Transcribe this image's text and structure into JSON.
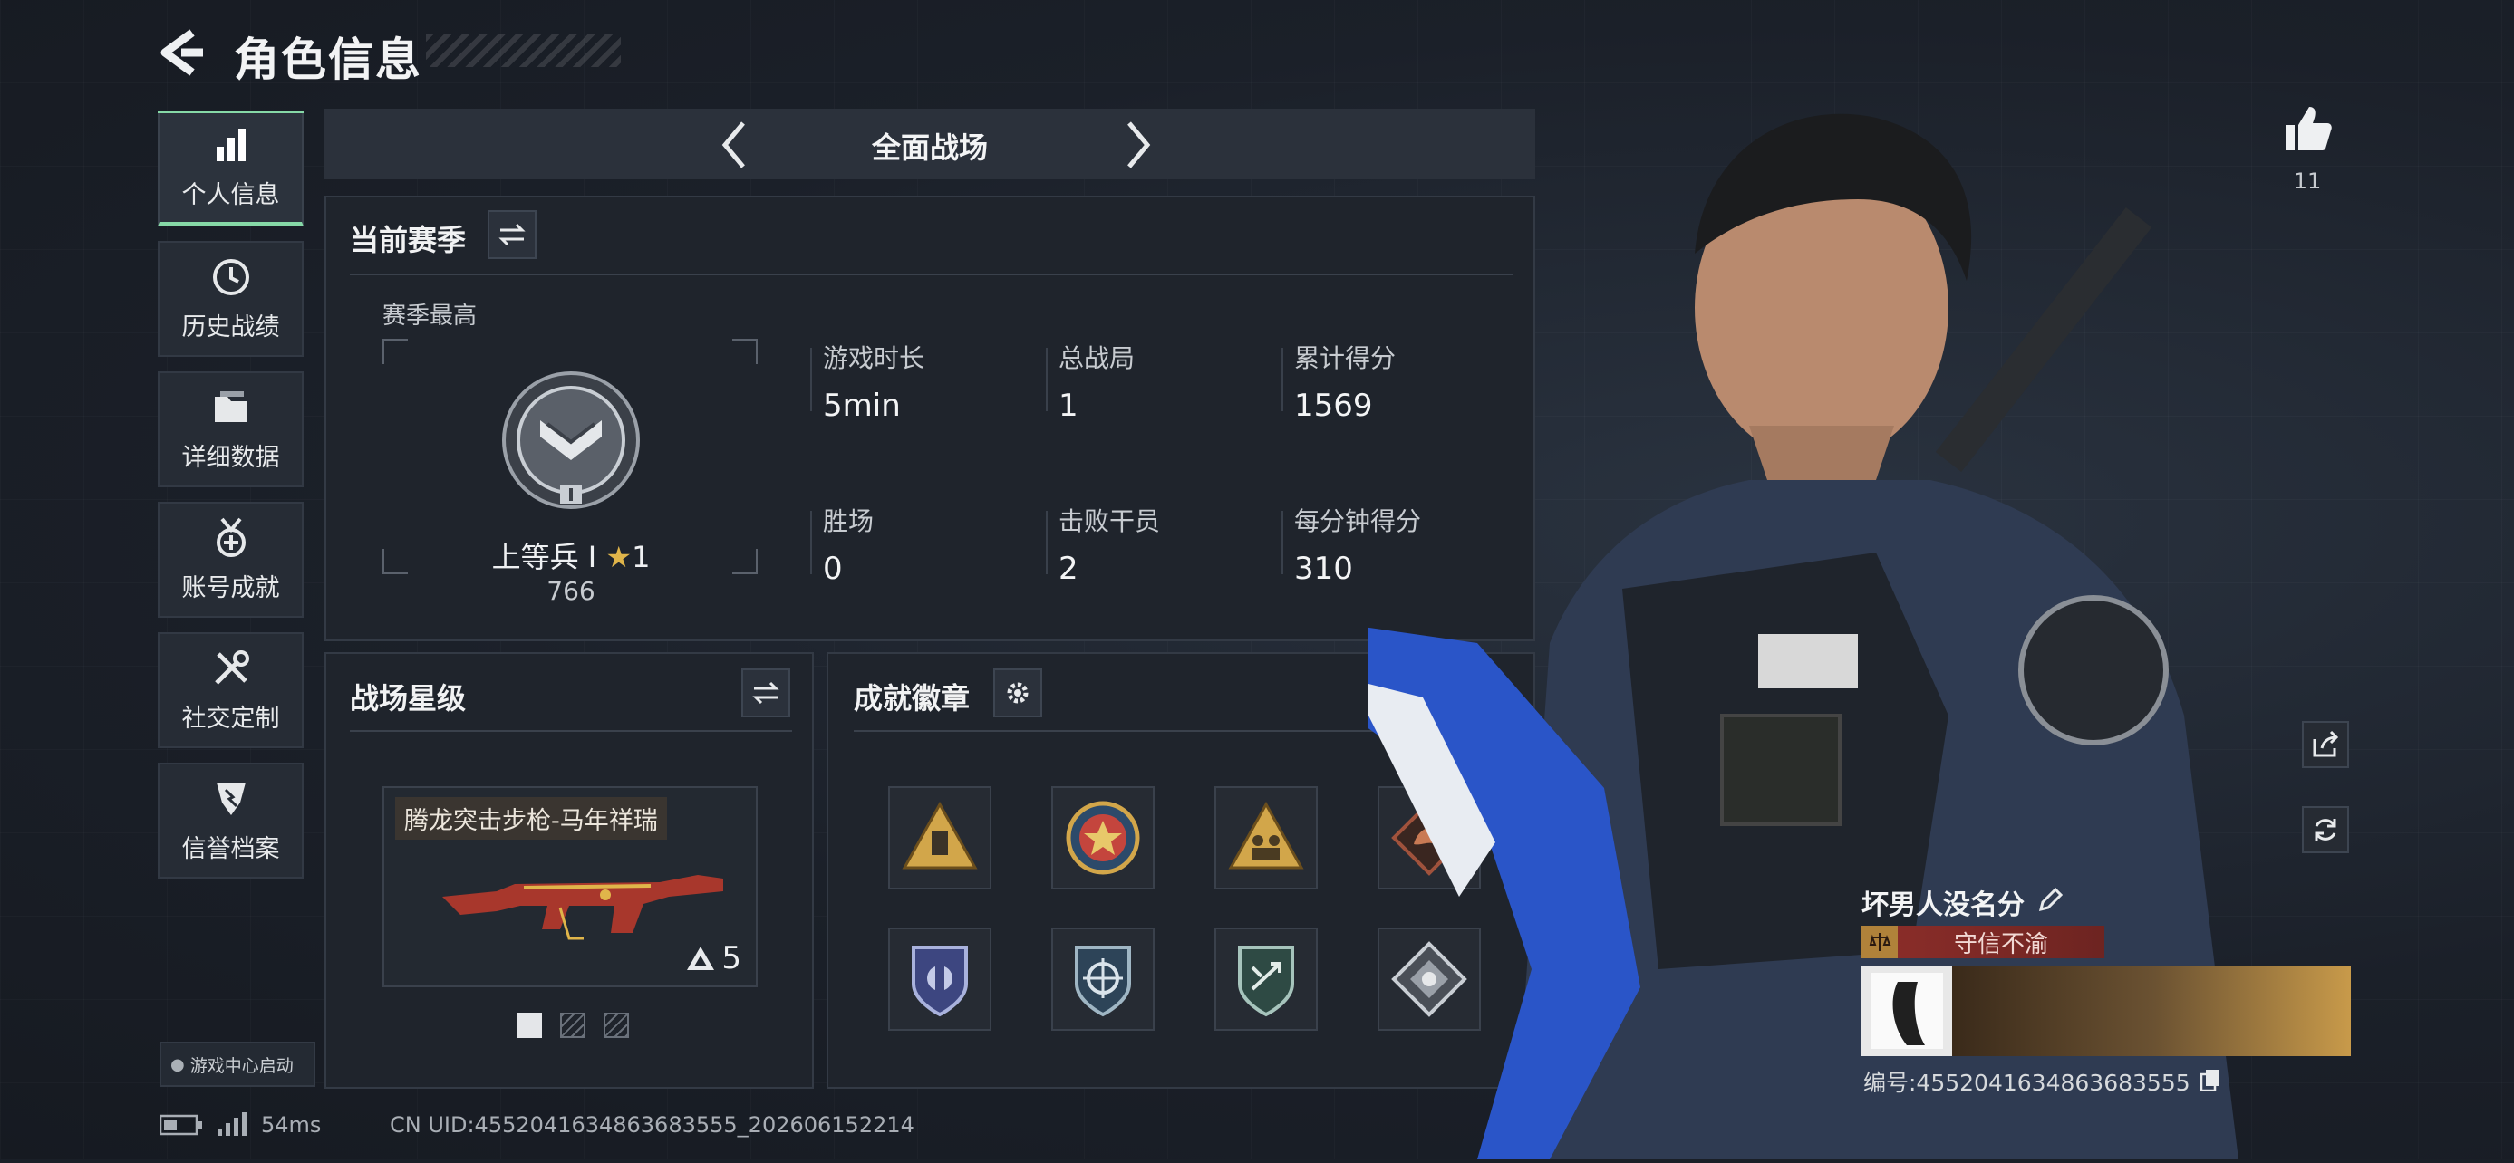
{
  "header": {
    "title": "角色信息"
  },
  "sidebar": {
    "items": [
      {
        "label": "个人信息",
        "icon": "bar-chart-icon",
        "active": true
      },
      {
        "label": "历史战绩",
        "icon": "history-clock-icon"
      },
      {
        "label": "详细数据",
        "icon": "folder-icon"
      },
      {
        "label": "账号成就",
        "icon": "achievement-medal-icon"
      },
      {
        "label": "社交定制",
        "icon": "tools-icon"
      },
      {
        "label": "信誉档案",
        "icon": "credit-shield-icon"
      }
    ],
    "game_center": "游戏中心启动"
  },
  "mode_bar": {
    "label": "全面战场"
  },
  "season": {
    "title": "当前赛季",
    "best_label": "赛季最高",
    "rank_name": "上等兵 Ⅰ",
    "rank_stars": "1",
    "rank_points": "766",
    "stats": [
      {
        "label": "游戏时长",
        "value": "5min"
      },
      {
        "label": "总战局",
        "value": "1"
      },
      {
        "label": "累计得分",
        "value": "1569"
      },
      {
        "label": "胜场",
        "value": "0"
      },
      {
        "label": "击败干员",
        "value": "2"
      },
      {
        "label": "每分钟得分",
        "value": "310"
      }
    ]
  },
  "star_level": {
    "title": "战场星级",
    "weapon_name": "腾龙突击步枪-马年祥瑞",
    "weapon_level": "5",
    "page_count": 3,
    "page_active": 1
  },
  "badges": {
    "title": "成就徽章",
    "items": [
      {
        "icon": "triangle-badge-icon",
        "color": "#d2a64a"
      },
      {
        "icon": "star-medal-badge-icon",
        "color": "#c4453d"
      },
      {
        "icon": "soldiers-badge-icon",
        "color": "#d2a64a"
      },
      {
        "icon": "dragon-badge-icon",
        "color": "#a0523c"
      },
      {
        "icon": "blue-shield-badge-icon",
        "color": "#6e7fc2"
      },
      {
        "icon": "crosshair-shield-badge-icon",
        "color": "#4f8fb0"
      },
      {
        "icon": "arrows-shield-badge-icon",
        "color": "#5aa09a"
      },
      {
        "icon": "silver-diamond-badge-icon",
        "color": "#9aa0a8"
      }
    ]
  },
  "player": {
    "likes": "11",
    "name": "坏男人没名分",
    "honor_tag": "守信不渝",
    "id_text": "编号:4552041634863683555"
  },
  "status_bar": {
    "latency": "54ms",
    "uid": "CN UID:4552041634863683555_202606152214"
  },
  "colors": {
    "accent_green": "#86d9a7",
    "honor_red": "#8e2e2a",
    "background": "#1a1f27"
  }
}
